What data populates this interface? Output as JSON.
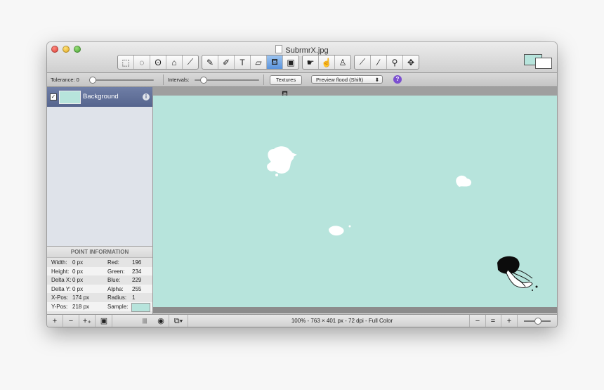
{
  "window": {
    "title": "SubrmrX.jpg",
    "colors": {
      "canvas": "#b7e4dc",
      "layer_selected": "#5f6e97",
      "active_tool": "#6a9de0"
    }
  },
  "toolbar": {
    "groups": [
      [
        {
          "name": "rect-select-icon",
          "glyph": "⬚"
        },
        {
          "name": "ellipse-select-icon",
          "glyph": "◌"
        },
        {
          "name": "lasso-icon",
          "glyph": "ʘ"
        },
        {
          "name": "polygon-lasso-icon",
          "glyph": "⌂"
        },
        {
          "name": "magic-wand-icon",
          "glyph": "⟋"
        }
      ],
      [
        {
          "name": "pencil-icon",
          "glyph": "✎"
        },
        {
          "name": "brush-icon",
          "glyph": "✐"
        },
        {
          "name": "text-tool-icon",
          "glyph": "T"
        },
        {
          "name": "eraser-icon",
          "glyph": "▱"
        },
        {
          "name": "paint-bucket-icon",
          "glyph": "⛾",
          "active": true
        },
        {
          "name": "gradient-icon",
          "glyph": "▣"
        }
      ],
      [
        {
          "name": "smudge-icon",
          "glyph": "☛"
        },
        {
          "name": "burn-icon",
          "glyph": "☝"
        },
        {
          "name": "clone-stamp-icon",
          "glyph": "♙"
        }
      ],
      [
        {
          "name": "eyedropper-icon",
          "glyph": "⟋"
        },
        {
          "name": "line-icon",
          "glyph": "⁄"
        },
        {
          "name": "zoom-icon",
          "glyph": "⚲"
        },
        {
          "name": "move-icon",
          "glyph": "✥"
        }
      ]
    ]
  },
  "options": {
    "tolerance_label": "Tolerance: 0",
    "intervals_label": "Intervals:",
    "textures_label": "Textures",
    "preview_label": "Preview flood (Shift)",
    "help_label": "?"
  },
  "layers": [
    {
      "name": "Background",
      "visible_mark": "✓",
      "info": "i"
    }
  ],
  "point_info": {
    "header": "POINT INFORMATION",
    "rows": [
      {
        "l1": "Width:",
        "v1": "0 px",
        "l2": "Red:",
        "v2": "196"
      },
      {
        "l1": "Height:",
        "v1": "0 px",
        "l2": "Green:",
        "v2": "234"
      },
      {
        "l1": "Delta X:",
        "v1": "0 px",
        "l2": "Blue:",
        "v2": "229"
      },
      {
        "l1": "Delta Y:",
        "v1": "0 px",
        "l2": "Alpha:",
        "v2": "255"
      },
      {
        "l1": "X-Pos:",
        "v1": "174 px",
        "l2": "Radius:",
        "v2": "1"
      },
      {
        "l1": "Y-Pos:",
        "v1": "218 px",
        "l2": "Sample:",
        "v2": ""
      }
    ]
  },
  "bottom": {
    "add_label": "+",
    "remove_label": "−",
    "duplicate_label": "+₊",
    "image_label": "▣",
    "grip_label": "|||",
    "eye_label": "◉",
    "layers_menu_label": "⧉▾",
    "status": "100% - 763 × 401 px - 72 dpi - Full Color",
    "zoom_out_label": "−",
    "zoom_fit_label": "=",
    "zoom_in_label": "+"
  }
}
